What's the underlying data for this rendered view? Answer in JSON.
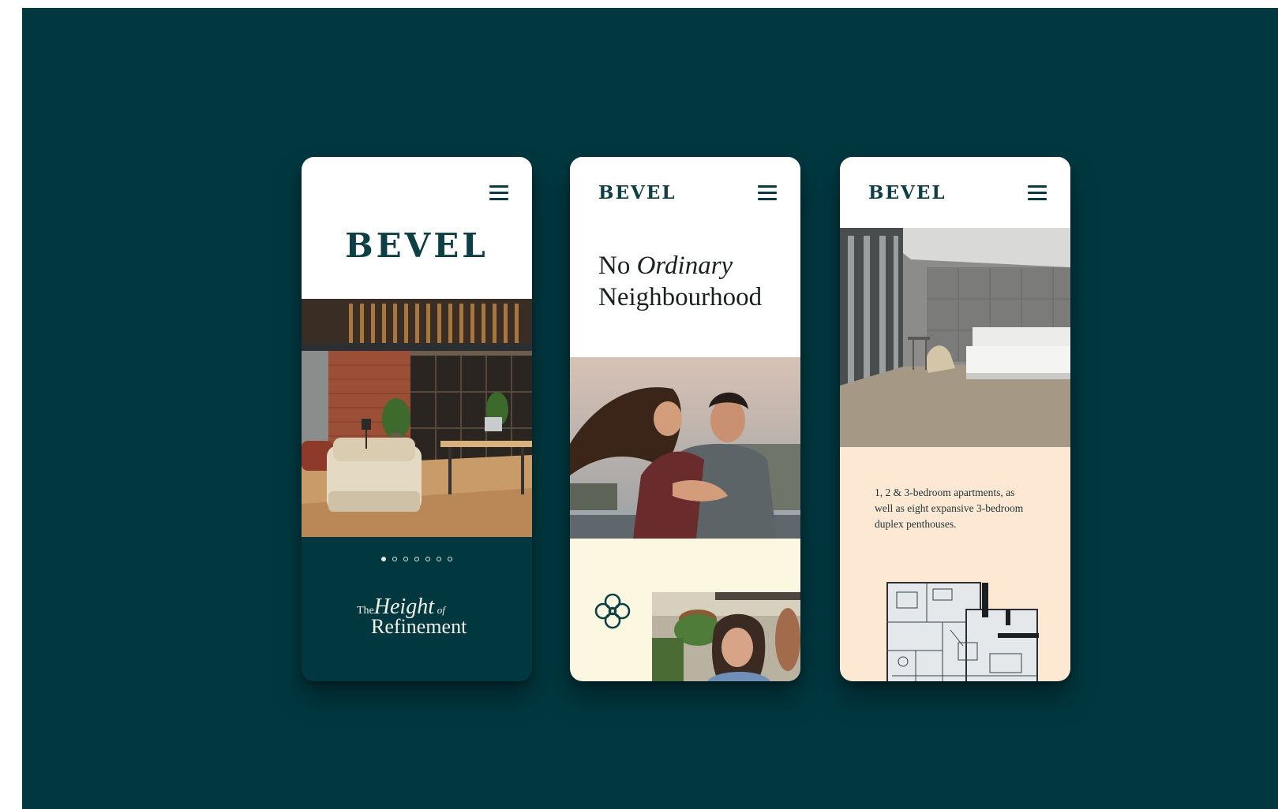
{
  "brand": {
    "name": "BEVEL",
    "colors": {
      "background": "#013840",
      "primary": "#0d3f45",
      "cream": "#fcf7e1",
      "peach": "#fde9d3"
    }
  },
  "screens": {
    "home": {
      "logo": "BEVEL",
      "menu_icon": "hamburger-menu-icon",
      "carousel": {
        "count": 7,
        "active": 1
      },
      "tagline": {
        "the": "The",
        "height": "Height",
        "of": "of",
        "refinement": "Refinement"
      }
    },
    "neighbourhood": {
      "logo": "BEVEL",
      "menu_icon": "hamburger-menu-icon",
      "headline_pre": "No",
      "headline_italic": "Ordinary",
      "headline_line2": "Neighbourhood",
      "decor_icon": "flower-icon"
    },
    "apartments": {
      "logo": "BEVEL",
      "menu_icon": "hamburger-menu-icon",
      "description": "1, 2 & 3-bedroom apartments, as well as eight expansive 3-bedroom duplex penthouses."
    }
  }
}
